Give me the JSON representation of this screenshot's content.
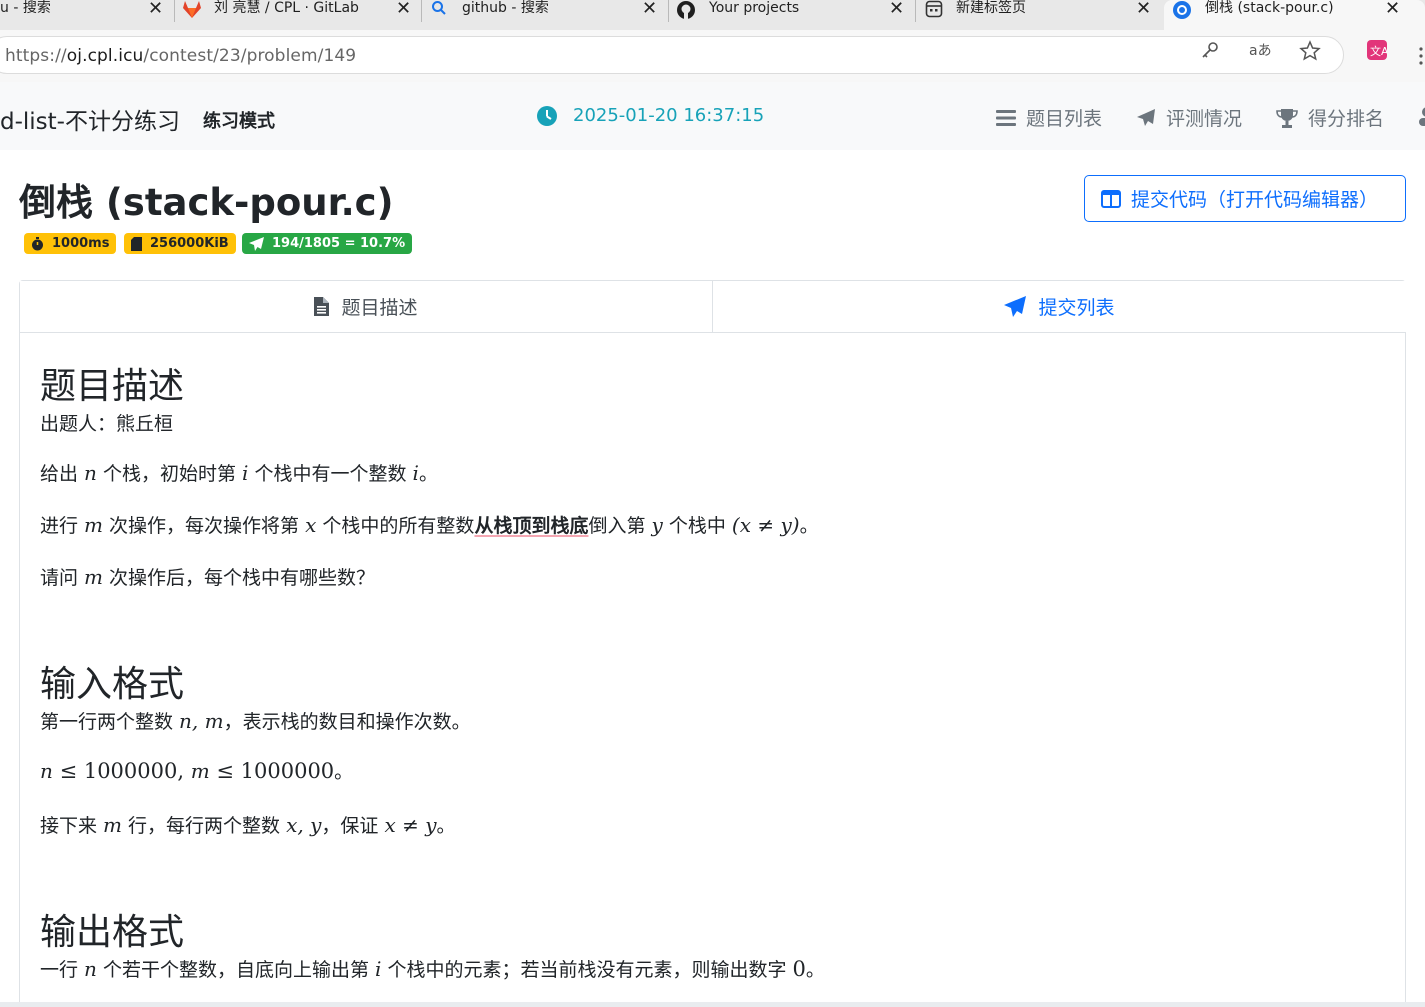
{
  "tabs": [
    {
      "title": "u - 搜索",
      "close": "✕",
      "icon": "none"
    },
    {
      "title": "刘 亮慧 / CPL · GitLab",
      "close": "✕",
      "icon": "gitlab-icon"
    },
    {
      "title": "github - 搜索",
      "close": "✕",
      "icon": "search-icon"
    },
    {
      "title": "Your projects",
      "close": "✕",
      "icon": "github-icon"
    },
    {
      "title": "新建标签页",
      "close": "✕",
      "icon": "newtab-icon"
    },
    {
      "title": "倒栈 (stack-pour.c)",
      "close": "✕",
      "icon": "chrome-icon"
    }
  ],
  "address": {
    "prefix": "https://",
    "host": "oj.cpl.icu",
    "path": "/contest/23/problem/149"
  },
  "navbar": {
    "brand": "d-list-不计分练习",
    "mode": "练习模式",
    "time": "2025-01-20 16:37:15",
    "links": [
      "题目列表",
      "评测情况",
      "得分排名"
    ]
  },
  "problem": {
    "title": "倒栈 (stack-pour.c)",
    "submit_label": "提交代码（打开代码编辑器）",
    "badges": {
      "time": "1000ms",
      "memory": "256000KiB",
      "accepted": "194/1805 = 10.7%"
    },
    "tabs": {
      "description": "题目描述",
      "submissions": "提交列表"
    }
  },
  "statement": {
    "desc_heading": "题目描述",
    "author": "出题人：熊丘桓",
    "line1": {
      "a": "给出 ",
      "n": "n",
      "b": " 个栈，初始时第 ",
      "i": "i",
      "c": " 个栈中有一个整数 ",
      "i2": "i",
      "d": "。"
    },
    "line2": {
      "a": "进行 ",
      "m": "m",
      "b": " 次操作，每次操作将第 ",
      "x": "x",
      "c": " 个栈中的所有整数",
      "bold": "从栈顶到栈底",
      "d": "倒入第 ",
      "y": "y",
      "e": " 个栈中 ",
      "cond": "(x ≠ y)",
      "f": "。"
    },
    "line3": {
      "a": "请问 ",
      "m": "m",
      "b": " 次操作后，每个栈中有哪些数？"
    },
    "input_heading": "输入格式",
    "input1": {
      "a": "第一行两个整数 ",
      "nm": "n, m",
      "b": "，表示栈的数目和操作次数。"
    },
    "input2": {
      "n": "n",
      "le1": " ≤ 1000000, ",
      "m": "m",
      "le2": " ≤ 1000000",
      "end": "。"
    },
    "input3": {
      "a": "接下来 ",
      "m": "m",
      "b": " 行，每行两个整数 ",
      "xy": "x, y",
      "c": "，保证 ",
      "cond": "x ≠ y",
      "d": "。"
    },
    "output_heading": "输出格式",
    "output1": {
      "a": "一行 ",
      "n": "n",
      "b": " 个若干个整数，自底向上输出第 ",
      "i": "i",
      "c": " 个栈中的元素；若当前栈没有元素，则输出数字 ",
      "zero": "0",
      "d": "。"
    }
  },
  "colors": {
    "accent": "#0d6efd",
    "info": "#17a2b8",
    "badge_warning": "#ffc107",
    "badge_success": "#28a745"
  }
}
